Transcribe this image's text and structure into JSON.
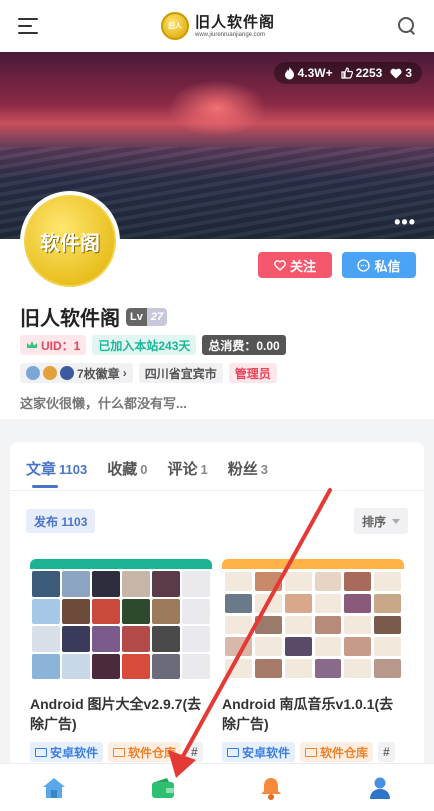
{
  "header": {
    "logo_badge": "旧人",
    "logo_title": "旧人软件阁",
    "logo_url": "www.jiurenruanjiange.com"
  },
  "banner": {
    "stats": {
      "hot": "4.3W+",
      "likes": "2253",
      "hearts": "3"
    },
    "more": "•••"
  },
  "profile": {
    "avatar_text": "软件阁",
    "follow_label": "关注",
    "message_label": "私信",
    "username": "旧人软件阁",
    "level_prefix": "Lv",
    "level": "27",
    "uid": "UID：1",
    "joined": "已加入本站243天",
    "consume": "总消费：0.00",
    "medals": "7枚徽章",
    "location": "四川省宜宾市",
    "role": "管理员",
    "bio": "这家伙很懒，什么都没有写..."
  },
  "tabs": [
    {
      "label": "文章",
      "count": "1103"
    },
    {
      "label": "收藏",
      "count": "0"
    },
    {
      "label": "评论",
      "count": "1"
    },
    {
      "label": "粉丝",
      "count": "3"
    }
  ],
  "content": {
    "publish_badge": "发布 1103",
    "sort_label": "排序"
  },
  "posts": [
    {
      "title": "Android 图片大全v2.9.7(去除广告)",
      "tag1": "安卓软件",
      "tag2": "软件仓库",
      "tag3": "#"
    },
    {
      "title": "Android 南瓜音乐v1.0.1(去除广告)",
      "tag1": "安卓软件",
      "tag2": "软件仓库",
      "tag3": "#"
    }
  ],
  "colors": {
    "accent": "#4a74c9",
    "follow": "#f5576c",
    "message": "#4aa3f5",
    "annotation_arrow": "#e53935"
  },
  "bottom_nav": [
    "home-icon",
    "wallet-icon",
    "bell-icon",
    "user-icon"
  ]
}
